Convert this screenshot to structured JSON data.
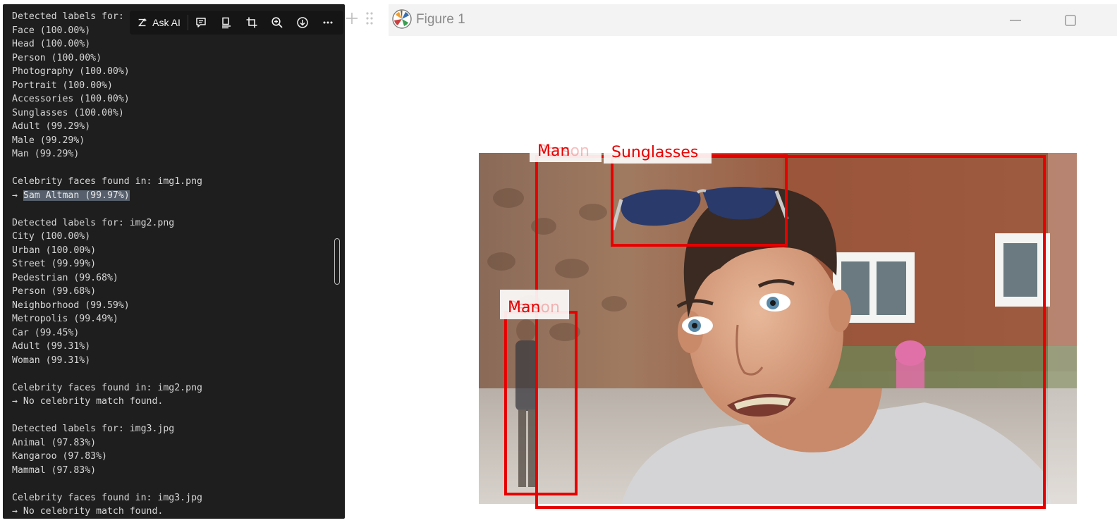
{
  "toolbar": {
    "ask_ai_label": "Ask AI",
    "buttons": [
      "comment-icon",
      "summary-icon",
      "crop-icon",
      "zoom-in-icon",
      "download-icon",
      "more-icon"
    ]
  },
  "terminal": {
    "lines": [
      "Detected labels for: img1.png",
      "Face (100.00%)",
      "Head (100.00%)",
      "Person (100.00%)",
      "Photography (100.00%)",
      "Portrait (100.00%)",
      "Accessories (100.00%)",
      "Sunglasses (100.00%)",
      "Adult (99.29%)",
      "Male (99.29%)",
      "Man (99.29%)",
      "",
      "Celebrity faces found in: img1.png",
      "→ Sam Altman (99.97%)",
      "",
      "Detected labels for: img2.png",
      "City (100.00%)",
      "Urban (100.00%)",
      "Street (99.99%)",
      "Pedestrian (99.68%)",
      "Person (99.68%)",
      "Neighborhood (99.59%)",
      "Metropolis (99.49%)",
      "Car (99.45%)",
      "Adult (99.31%)",
      "Woman (99.31%)",
      "",
      "Celebrity faces found in: img2.png",
      "→ No celebrity match found.",
      "",
      "Detected labels for: img3.jpg",
      "Animal (97.83%)",
      "Kangaroo (97.83%)",
      "Mammal (97.83%)",
      "",
      "Celebrity faces found in: img3.jpg",
      "→ No celebrity match found."
    ],
    "highlighted_line": 13,
    "highlighted_text": "Sam Altman (99.97%)"
  },
  "figure": {
    "title": "Figure 1",
    "box_color": "#e60000",
    "label_color": "#e60000",
    "labels": {
      "person_main": "Man",
      "person_main_overlap": "Person",
      "sunglasses": "Sunglasses",
      "person_left": "Man",
      "person_left_overlap": "Person"
    }
  }
}
